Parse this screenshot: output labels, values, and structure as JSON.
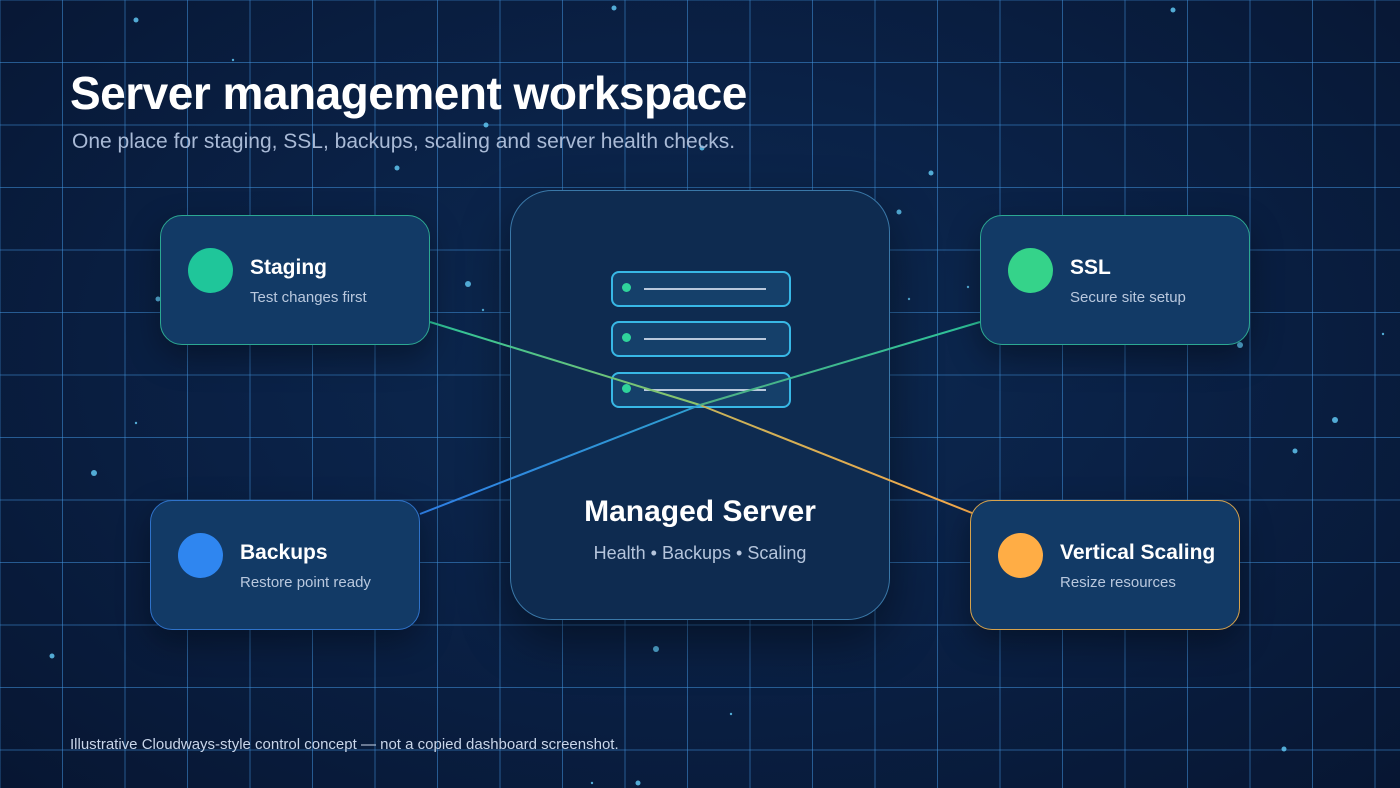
{
  "header": {
    "title": "Server management workspace",
    "subtitle": "One place for staging, SSL, backups, scaling and server health checks."
  },
  "hub": {
    "title": "Managed Server",
    "subtitle": "Health • Backups • Scaling",
    "icon": "server-rack-icon"
  },
  "cards": {
    "staging": {
      "title": "Staging",
      "subtitle": "Test changes first",
      "color": "#1fc69a"
    },
    "ssl": {
      "title": "SSL",
      "subtitle": "Secure site setup",
      "color": "#35d38a"
    },
    "backups": {
      "title": "Backups",
      "subtitle": "Restore point ready",
      "color": "#2f86f0"
    },
    "scaling": {
      "title": "Vertical Scaling",
      "subtitle": "Resize resources",
      "color": "#ffad45"
    }
  },
  "colors": {
    "background": "#081a36",
    "grid": "#3f8fd8",
    "hub_border": "#3a78a8",
    "connector_green": "#2cc39a",
    "connector_blue": "#2f7fe6",
    "connector_orange": "#f5a84a"
  },
  "footnote": "Illustrative Cloudways-style control concept — not a copied dashboard screenshot."
}
